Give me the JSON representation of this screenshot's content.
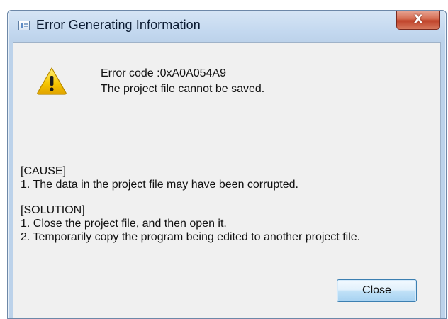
{
  "window": {
    "title": "Error Generating Information",
    "close_glyph": "X"
  },
  "message": {
    "error_code": "Error code :0xA0A054A9",
    "summary": "The project file cannot be saved.",
    "icon": "warning-icon"
  },
  "cause": {
    "heading": "[CAUSE]",
    "lines": [
      "1. The data in the project file may have been corrupted."
    ]
  },
  "solution": {
    "heading": "[SOLUTION]",
    "lines": [
      "1. Close the project file, and then open it.",
      "2. Temporarily copy the program being edited to another project file."
    ]
  },
  "buttons": {
    "close_label": "Close"
  },
  "colors": {
    "title_close_red": "#c0432a",
    "warning_yellow": "#f5c400",
    "button_blue": "#a7d2f1"
  }
}
